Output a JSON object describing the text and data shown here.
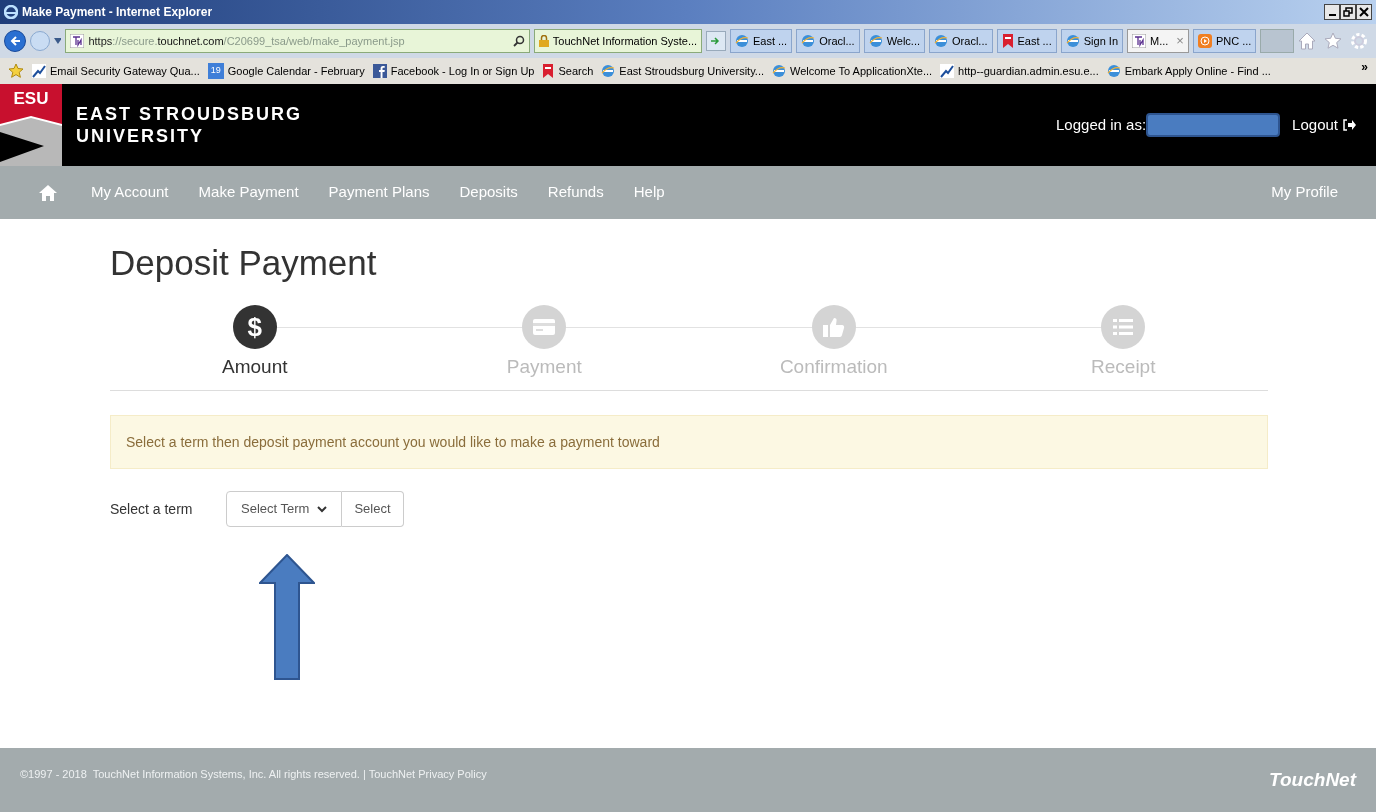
{
  "window": {
    "title": "Make Payment - Internet Explorer"
  },
  "address_bar": {
    "scheme": "https",
    "host_prefix": "://secure.",
    "host": "touchnet.com",
    "path": "/C20699_tsa/web/make_payment.jsp",
    "site_identity": "TouchNet Information Syste..."
  },
  "tabs": [
    {
      "label": "East ...",
      "kind": "ie",
      "selected": false
    },
    {
      "label": "Oracl...",
      "kind": "ie",
      "selected": false
    },
    {
      "label": "Welc...",
      "kind": "ie",
      "selected": false
    },
    {
      "label": "Oracl...",
      "kind": "ie",
      "selected": false
    },
    {
      "label": "East ...",
      "kind": "bookmark",
      "selected": false
    },
    {
      "label": "Sign In",
      "kind": "ie",
      "selected": false
    },
    {
      "label": "M...",
      "kind": "touchnet",
      "selected": true,
      "close": "×"
    },
    {
      "label": "PNC ...",
      "kind": "play",
      "selected": false
    }
  ],
  "favorites": [
    {
      "label": "Email Security Gateway Qua...",
      "kind": "chart"
    },
    {
      "label": "Google Calendar - February",
      "kind": "calendar",
      "badge": "19"
    },
    {
      "label": "Facebook - Log In or Sign Up",
      "kind": "facebook"
    },
    {
      "label": "Search",
      "kind": "bookmark"
    },
    {
      "label": "East Stroudsburg University...",
      "kind": "ie"
    },
    {
      "label": "Welcome To ApplicationXte...",
      "kind": "ie"
    },
    {
      "label": "http--guardian.admin.esu.e...",
      "kind": "chart"
    },
    {
      "label": "Embark Apply Online - Find ...",
      "kind": "ie"
    }
  ],
  "favorites_overflow": "»",
  "header": {
    "logo_text": "ESU",
    "name_line1": "EAST STROUDSBURG",
    "name_line2": "UNIVERSITY",
    "logged_in_label": "Logged in as:",
    "logout": "Logout"
  },
  "nav": {
    "items": [
      "My Account",
      "Make Payment",
      "Payment Plans",
      "Deposits",
      "Refunds",
      "Help"
    ],
    "profile": "My Profile"
  },
  "page": {
    "title": "Deposit Payment",
    "steps": [
      {
        "label": "Amount",
        "kind": "dollar",
        "selected": true,
        "glyph": "$"
      },
      {
        "label": "Payment",
        "kind": "card",
        "selected": false
      },
      {
        "label": "Confirmation",
        "kind": "thumb",
        "selected": false
      },
      {
        "label": "Receipt",
        "kind": "list",
        "selected": false
      }
    ],
    "notice": "Select a term then deposit payment account you would like to make a payment toward",
    "term_label": "Select a term",
    "term_dropdown": "Select Term",
    "select_button": "Select"
  },
  "footer": {
    "copyright": "©1997 - 2018  TouchNet Information Systems, Inc. All rights reserved. | TouchNet Privacy Policy",
    "brand": "TouchNet"
  }
}
